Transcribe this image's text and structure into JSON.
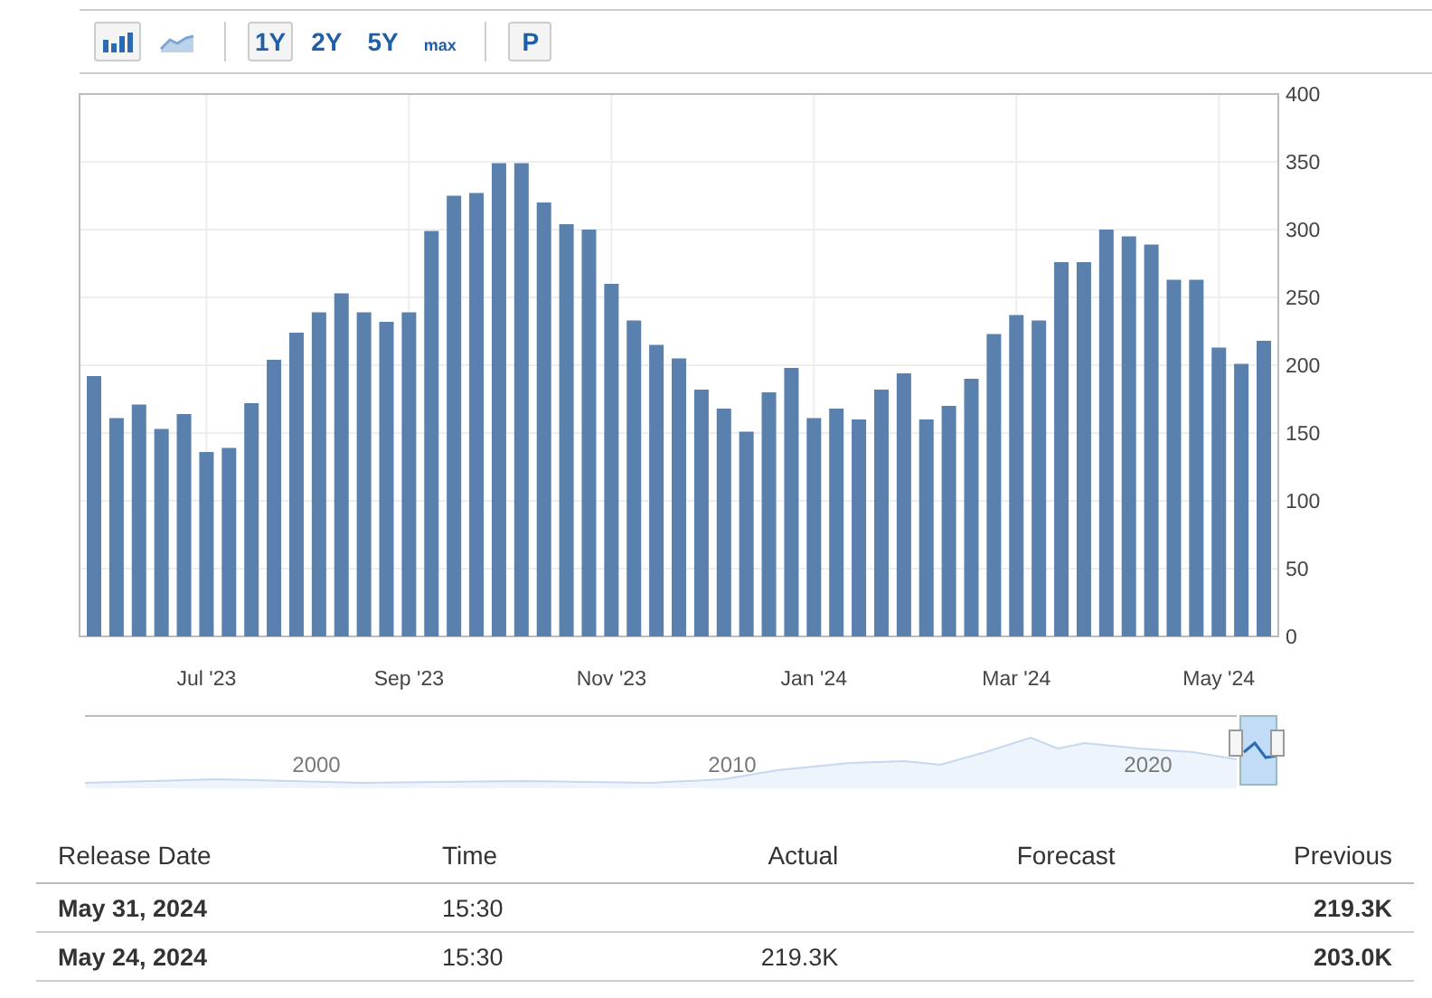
{
  "toolbar": {
    "chart_types": [
      {
        "kind": "bars",
        "selected": true
      },
      {
        "kind": "area",
        "selected": false
      }
    ],
    "ranges": [
      {
        "label": "1Y",
        "selected": true
      },
      {
        "label": "2Y",
        "selected": false
      },
      {
        "label": "5Y",
        "selected": false
      },
      {
        "label": "max",
        "selected": false
      }
    ],
    "extra_button": {
      "label": "P"
    }
  },
  "chart": {
    "chart_data": {
      "type": "bar",
      "values": [
        192,
        161,
        171,
        153,
        164,
        136,
        139,
        172,
        204,
        224,
        239,
        253,
        239,
        232,
        239,
        299,
        325,
        327,
        349,
        349,
        320,
        304,
        300,
        260,
        233,
        215,
        205,
        182,
        168,
        151,
        180,
        198,
        161,
        168,
        160,
        182,
        194,
        160,
        170,
        190,
        223,
        237,
        233,
        276,
        276,
        300,
        295,
        289,
        263,
        263,
        213,
        201,
        218
      ],
      "categories": [
        null,
        null,
        null,
        null,
        null,
        "Jul '23",
        null,
        null,
        null,
        null,
        null,
        null,
        null,
        null,
        "Sep '23",
        null,
        null,
        null,
        null,
        null,
        null,
        null,
        null,
        "Nov '23",
        null,
        null,
        null,
        null,
        null,
        null,
        null,
        null,
        "Jan '24",
        null,
        null,
        null,
        null,
        null,
        null,
        null,
        null,
        "Mar '24",
        null,
        null,
        null,
        null,
        null,
        null,
        null,
        null,
        "May '24",
        null,
        null
      ],
      "grid": true,
      "ylim": [
        0,
        400
      ],
      "yticks": [
        0,
        50,
        100,
        150,
        200,
        250,
        300,
        350,
        400
      ]
    }
  },
  "navigator": {
    "labels": [
      "2000",
      "2010",
      "2020"
    ]
  },
  "table": {
    "columns": [
      "Release Date",
      "Time",
      "Actual",
      "Forecast",
      "Previous"
    ],
    "rows": [
      [
        "May 31, 2024",
        "15:30",
        "",
        "",
        "219.3K"
      ],
      [
        "May 24, 2024",
        "15:30",
        "219.3K",
        "",
        "203.0K"
      ]
    ]
  }
}
